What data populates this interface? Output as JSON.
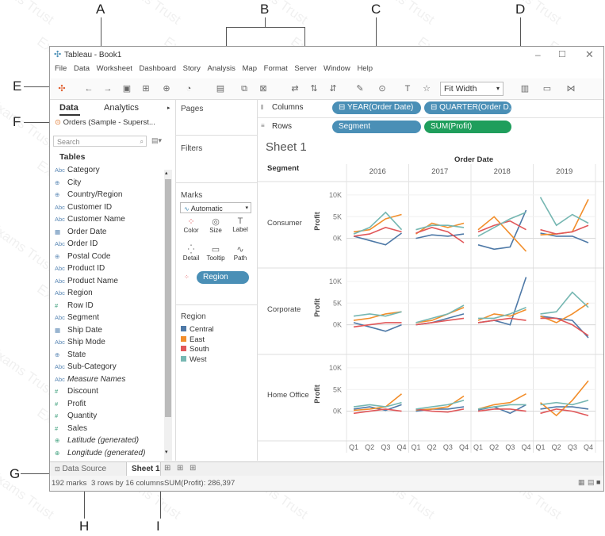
{
  "callouts": {
    "a": "A",
    "b": "B",
    "c": "C",
    "d": "D",
    "e": "E",
    "f": "F",
    "g": "G",
    "h": "H",
    "i": "I"
  },
  "watermark": "Exams Trust",
  "titlebar": {
    "title": "Tableau - Book1"
  },
  "menu": [
    "File",
    "Data",
    "Worksheet",
    "Dashboard",
    "Story",
    "Analysis",
    "Map",
    "Format",
    "Server",
    "Window",
    "Help"
  ],
  "toolbar": {
    "fit": "Fit Width"
  },
  "left_pane": {
    "tab_data": "Data",
    "tab_analytics": "Analytics",
    "datasource": "Orders (Sample - Superst...",
    "search_placeholder": "Search",
    "tables_header": "Tables",
    "fields": [
      {
        "name": "Category",
        "icon": "Abc"
      },
      {
        "name": "City",
        "icon": "⊕"
      },
      {
        "name": "Country/Region",
        "icon": "⊕"
      },
      {
        "name": "Customer ID",
        "icon": "Abc"
      },
      {
        "name": "Customer Name",
        "icon": "Abc"
      },
      {
        "name": "Order Date",
        "icon": "▦"
      },
      {
        "name": "Order ID",
        "icon": "Abc"
      },
      {
        "name": "Postal Code",
        "icon": "⊕"
      },
      {
        "name": "Product ID",
        "icon": "Abc"
      },
      {
        "name": "Product Name",
        "icon": "Abc"
      },
      {
        "name": "Region",
        "icon": "Abc"
      },
      {
        "name": "Row ID",
        "icon": "#"
      },
      {
        "name": "Segment",
        "icon": "Abc"
      },
      {
        "name": "Ship Date",
        "icon": "▦"
      },
      {
        "name": "Ship Mode",
        "icon": "Abc"
      },
      {
        "name": "State",
        "icon": "⊕"
      },
      {
        "name": "Sub-Category",
        "icon": "Abc"
      },
      {
        "name": "Measure Names",
        "icon": "Abc"
      },
      {
        "name": "Discount",
        "icon": "#"
      },
      {
        "name": "Profit",
        "icon": "#"
      },
      {
        "name": "Quantity",
        "icon": "#"
      },
      {
        "name": "Sales",
        "icon": "#"
      },
      {
        "name": "Latitude (generated)",
        "icon": "⊕"
      },
      {
        "name": "Longitude (generated)",
        "icon": "⊕"
      }
    ]
  },
  "cards": {
    "pages": "Pages",
    "filters": "Filters",
    "marks": "Marks",
    "mark_type": "Automatic",
    "mark_buttons": [
      "Color",
      "Size",
      "Label",
      "Detail",
      "Tooltip",
      "Path"
    ],
    "region_pill": "Region",
    "legend_title": "Region",
    "legend": [
      {
        "name": "Central",
        "color": "#4e79a7"
      },
      {
        "name": "East",
        "color": "#f28e2b"
      },
      {
        "name": "South",
        "color": "#e15759"
      },
      {
        "name": "West",
        "color": "#76b7b2"
      }
    ]
  },
  "shelves": {
    "columns_label": "Columns",
    "rows_label": "Rows",
    "col_pill_1": "YEAR(Order Date)",
    "col_pill_2": "QUARTER(Order D...",
    "row_pill_1": "Segment",
    "row_pill_2": "SUM(Profit)"
  },
  "view": {
    "sheet_title": "Sheet 1",
    "segment_header": "Segment",
    "order_date_header": "Order Date",
    "years": [
      "2016",
      "2017",
      "2018",
      "2019"
    ],
    "segments": [
      "Consumer",
      "Corporate",
      "Home Office"
    ],
    "axis_label": "Profit",
    "ticks": [
      "10K",
      "5K",
      "0K"
    ],
    "quarters": [
      "Q1",
      "Q2",
      "Q3",
      "Q4"
    ]
  },
  "sheetbar": {
    "datasource_tab": "Data Source",
    "sheet_tab": "Sheet 1"
  },
  "status": {
    "marks": "192 marks",
    "rowscols": "3 rows by 16 columns",
    "sum": "SUM(Profit): 286,397"
  },
  "chart_data": {
    "type": "line",
    "xlabel": "Order Date",
    "ylabel": "Profit",
    "ylim": [
      -3000,
      12000
    ],
    "panels": [
      {
        "segment": "Consumer",
        "series": [
          {
            "name": "Central",
            "values": [
              [
                500,
                -500,
                -1500,
                1200
              ],
              [
                0,
                800,
                500,
                1000
              ],
              [
                -1500,
                -2500,
                -2000,
                6500
              ],
              [
                1200,
                500,
                500,
                -1000
              ]
            ]
          },
          {
            "name": "East",
            "values": [
              [
                1500,
                2000,
                4500,
                5500
              ],
              [
                1000,
                3500,
                2500,
                3500
              ],
              [
                2000,
                5000,
                1000,
                -3000
              ],
              [
                800,
                1000,
                1500,
                9000
              ]
            ]
          },
          {
            "name": "South",
            "values": [
              [
                500,
                1000,
                2500,
                1500
              ],
              [
                1200,
                2500,
                1500,
                -1000
              ],
              [
                1500,
                3000,
                4000,
                2000
              ],
              [
                2000,
                1000,
                1500,
                3000
              ]
            ]
          },
          {
            "name": "West",
            "values": [
              [
                1000,
                2500,
                6000,
                2000
              ],
              [
                2000,
                3000,
                3000,
                2500
              ],
              [
                500,
                2500,
                4500,
                6000
              ],
              [
                9500,
                3000,
                5500,
                3500
              ]
            ]
          }
        ]
      },
      {
        "segment": "Corporate",
        "series": [
          {
            "name": "Central",
            "values": [
              [
                500,
                -500,
                -1500,
                0
              ],
              [
                0,
                500,
                1500,
                2500
              ],
              [
                500,
                1000,
                0,
                11000
              ],
              [
                2000,
                1500,
                1000,
                -3000
              ]
            ]
          },
          {
            "name": "East",
            "values": [
              [
                1000,
                1500,
                2500,
                3000
              ],
              [
                500,
                1000,
                2500,
                4000
              ],
              [
                1000,
                2500,
                2000,
                3500
              ],
              [
                2000,
                500,
                2500,
                5000
              ]
            ]
          },
          {
            "name": "South",
            "values": [
              [
                -500,
                0,
                500,
                500
              ],
              [
                0,
                500,
                1000,
                1500
              ],
              [
                500,
                1000,
                1500,
                1000
              ],
              [
                1500,
                1500,
                0,
                -2500
              ]
            ]
          },
          {
            "name": "West",
            "values": [
              [
                2000,
                2500,
                2000,
                3000
              ],
              [
                500,
                1500,
                2500,
                4500
              ],
              [
                1500,
                1500,
                2500,
                4000
              ],
              [
                2500,
                3000,
                7500,
                4000
              ]
            ]
          }
        ]
      },
      {
        "segment": "Home Office",
        "series": [
          {
            "name": "Central",
            "values": [
              [
                500,
                1000,
                200,
                1500
              ],
              [
                0,
                500,
                500,
                1000
              ],
              [
                300,
                1000,
                -500,
                1500
              ],
              [
                500,
                1000,
                1000,
                500
              ]
            ]
          },
          {
            "name": "East",
            "values": [
              [
                200,
                500,
                1000,
                4000
              ],
              [
                300,
                500,
                1000,
                3500
              ],
              [
                500,
                1500,
                2000,
                4000
              ],
              [
                2000,
                -1000,
                2500,
                7000
              ]
            ]
          },
          {
            "name": "South",
            "values": [
              [
                -500,
                0,
                500,
                0
              ],
              [
                500,
                0,
                -200,
                500
              ],
              [
                0,
                500,
                500,
                0
              ],
              [
                -500,
                500,
                0,
                -1000
              ]
            ]
          },
          {
            "name": "West",
            "values": [
              [
                1000,
                1500,
                1000,
                2000
              ],
              [
                500,
                1000,
                1500,
                2500
              ],
              [
                500,
                1000,
                1500,
                1500
              ],
              [
                1500,
                2000,
                1500,
                2500
              ]
            ]
          }
        ]
      }
    ]
  }
}
